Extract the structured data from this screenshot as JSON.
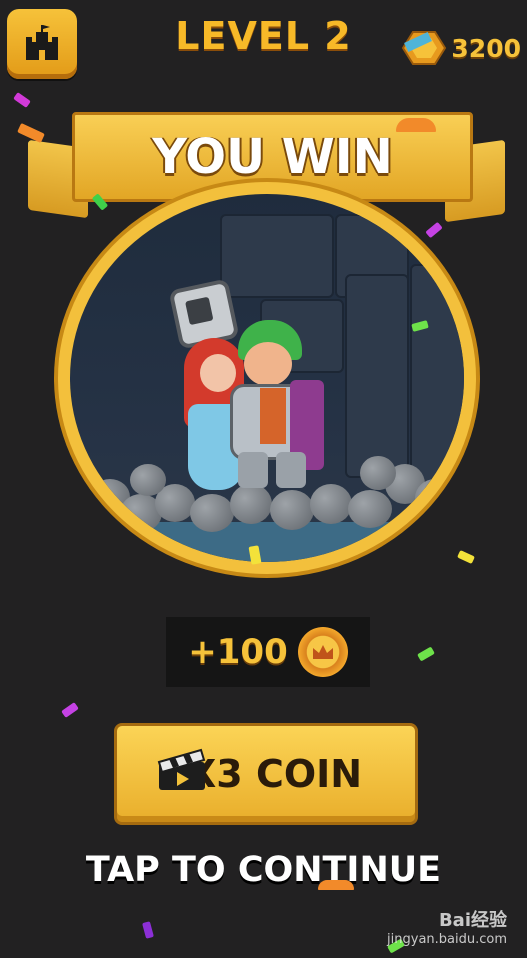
{
  "header": {
    "level_label": "LEVEL 2",
    "coin_balance": "3200"
  },
  "result": {
    "banner_text": "YOU WIN",
    "reward_text": "+100"
  },
  "actions": {
    "x3_label": "X3 COIN",
    "continue_label": "TAP TO CONTINUE"
  },
  "watermark": {
    "brand": "Bai经验",
    "url": "jingyan.baidu.com"
  },
  "colors": {
    "background": "#222122",
    "accent_gold": "#f6c23a",
    "scene_blue": "#253245"
  }
}
